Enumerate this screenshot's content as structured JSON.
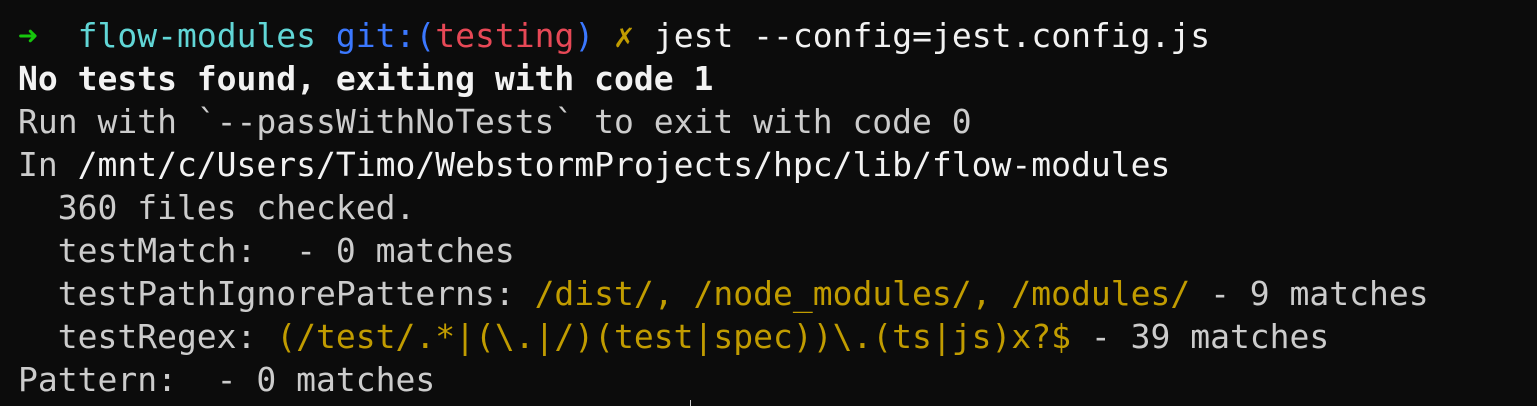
{
  "prompt": {
    "arrow": "➜",
    "directory": "flow-modules",
    "git_label": "git:(",
    "branch": "testing",
    "git_close": ")",
    "dirty_mark": "✗",
    "command": "jest --config=jest.config.js"
  },
  "output": {
    "no_tests": "No tests found, exiting with code 1",
    "run_with": "Run with `--passWithNoTests` to exit with code 0",
    "in_label": "In ",
    "in_path": "/mnt/c/Users/Timo/WebstormProjects/hpc/lib/flow-modules",
    "files_checked": "  360 files checked.",
    "test_match": "  testMatch:  - 0 matches",
    "ignore_label": "  testPathIgnorePatterns: ",
    "ignore_patterns": "/dist/, /node_modules/, /modules/",
    "ignore_count": " - 9 matches",
    "regex_label": "  testRegex: ",
    "regex_value": "(/test/.*|(\\.|/)(test|spec))\\.(ts|js)x?$",
    "regex_count": " - 39 matches",
    "pattern": "Pattern:  - 0 matches"
  },
  "colors": {
    "background": "#0c0c0c",
    "foreground": "#cccccc",
    "arrow": "#16c60c",
    "directory": "#61d6d6",
    "git": "#3b78ff",
    "branch": "#e74856",
    "highlight": "#c19c00"
  }
}
